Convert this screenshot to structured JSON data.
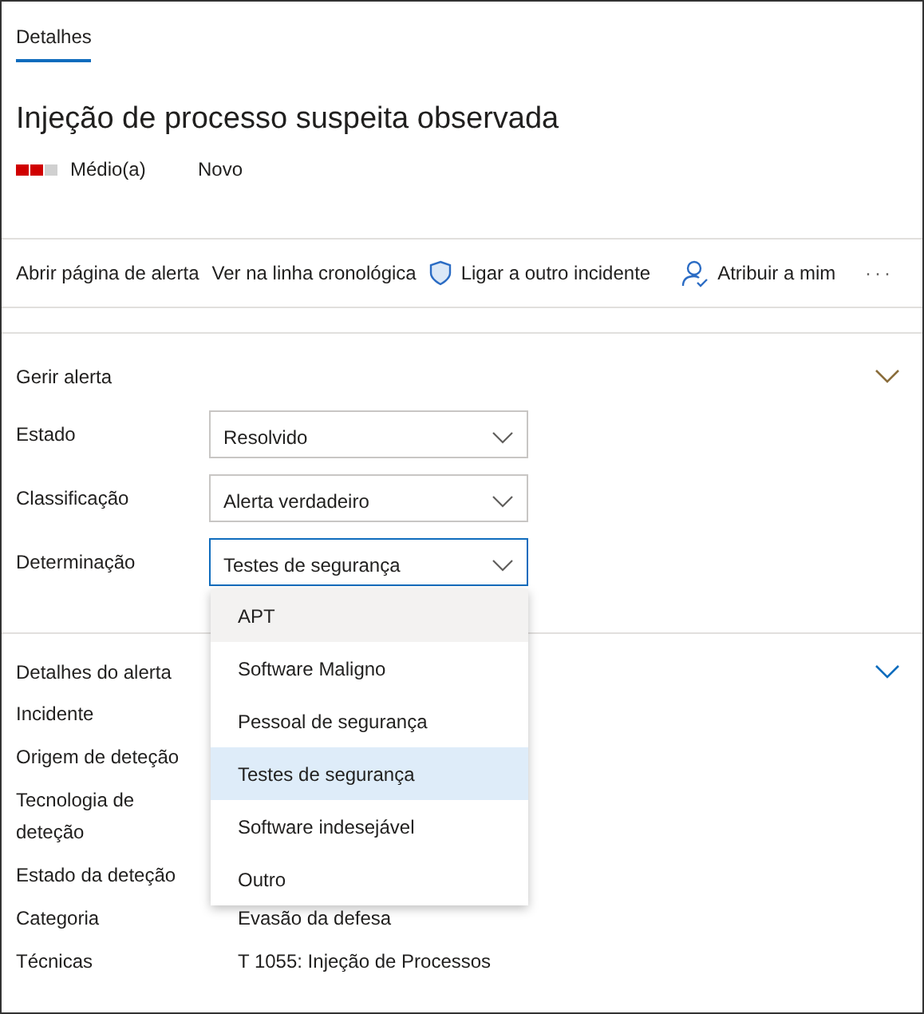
{
  "tabs": [
    {
      "label": "Detalhes",
      "selected": true
    }
  ],
  "title": "Injeção de processo suspeita observada",
  "severity": {
    "level": 0.67,
    "label": "Médio(a)"
  },
  "status": "Novo",
  "toolbar": [
    {
      "kind": "text",
      "label": "Abrir página de alerta"
    },
    {
      "kind": "text",
      "label": "Ver na linha cronológica"
    },
    {
      "kind": "shield",
      "label": "Ligar a outro incidente"
    },
    {
      "kind": "person",
      "label": "Atribuir a mim"
    },
    {
      "kind": "more",
      "label": "···"
    }
  ],
  "manage": {
    "title": "Gerir alerta",
    "expanded": true,
    "fields": [
      {
        "label": "Estado",
        "value": "Resolvido",
        "focused": false
      },
      {
        "label": "Classificação",
        "value": "Alerta verdadeiro",
        "focused": false
      },
      {
        "label": "Determinação",
        "value": "Testes de segurança",
        "focused": true
      }
    ]
  },
  "menu": [
    {
      "label": "APT",
      "selected": false,
      "hovered": true
    },
    {
      "label": "Software Maligno",
      "selected": false,
      "hovered": false
    },
    {
      "label": "Pessoal de segurança",
      "selected": false,
      "hovered": false
    },
    {
      "label": "Testes de segurança",
      "selected": true,
      "hovered": false
    },
    {
      "label": "Software indesejável",
      "selected": false,
      "hovered": false
    },
    {
      "label": "Outro",
      "selected": false,
      "hovered": false
    }
  ],
  "details": {
    "title": "Detalhes do alerta",
    "expanded": true,
    "rows": [
      {
        "label": "Incidente"
      },
      {
        "label": "Origem de deteção"
      },
      {
        "label": "Tecnologia de deteção"
      },
      {
        "label": "Estado da deteção"
      },
      {
        "label": "Categoria",
        "value": "Evasão da defesa"
      },
      {
        "label": "Técnicas",
        "value": "T 1055: Injeção de Processos"
      }
    ]
  }
}
